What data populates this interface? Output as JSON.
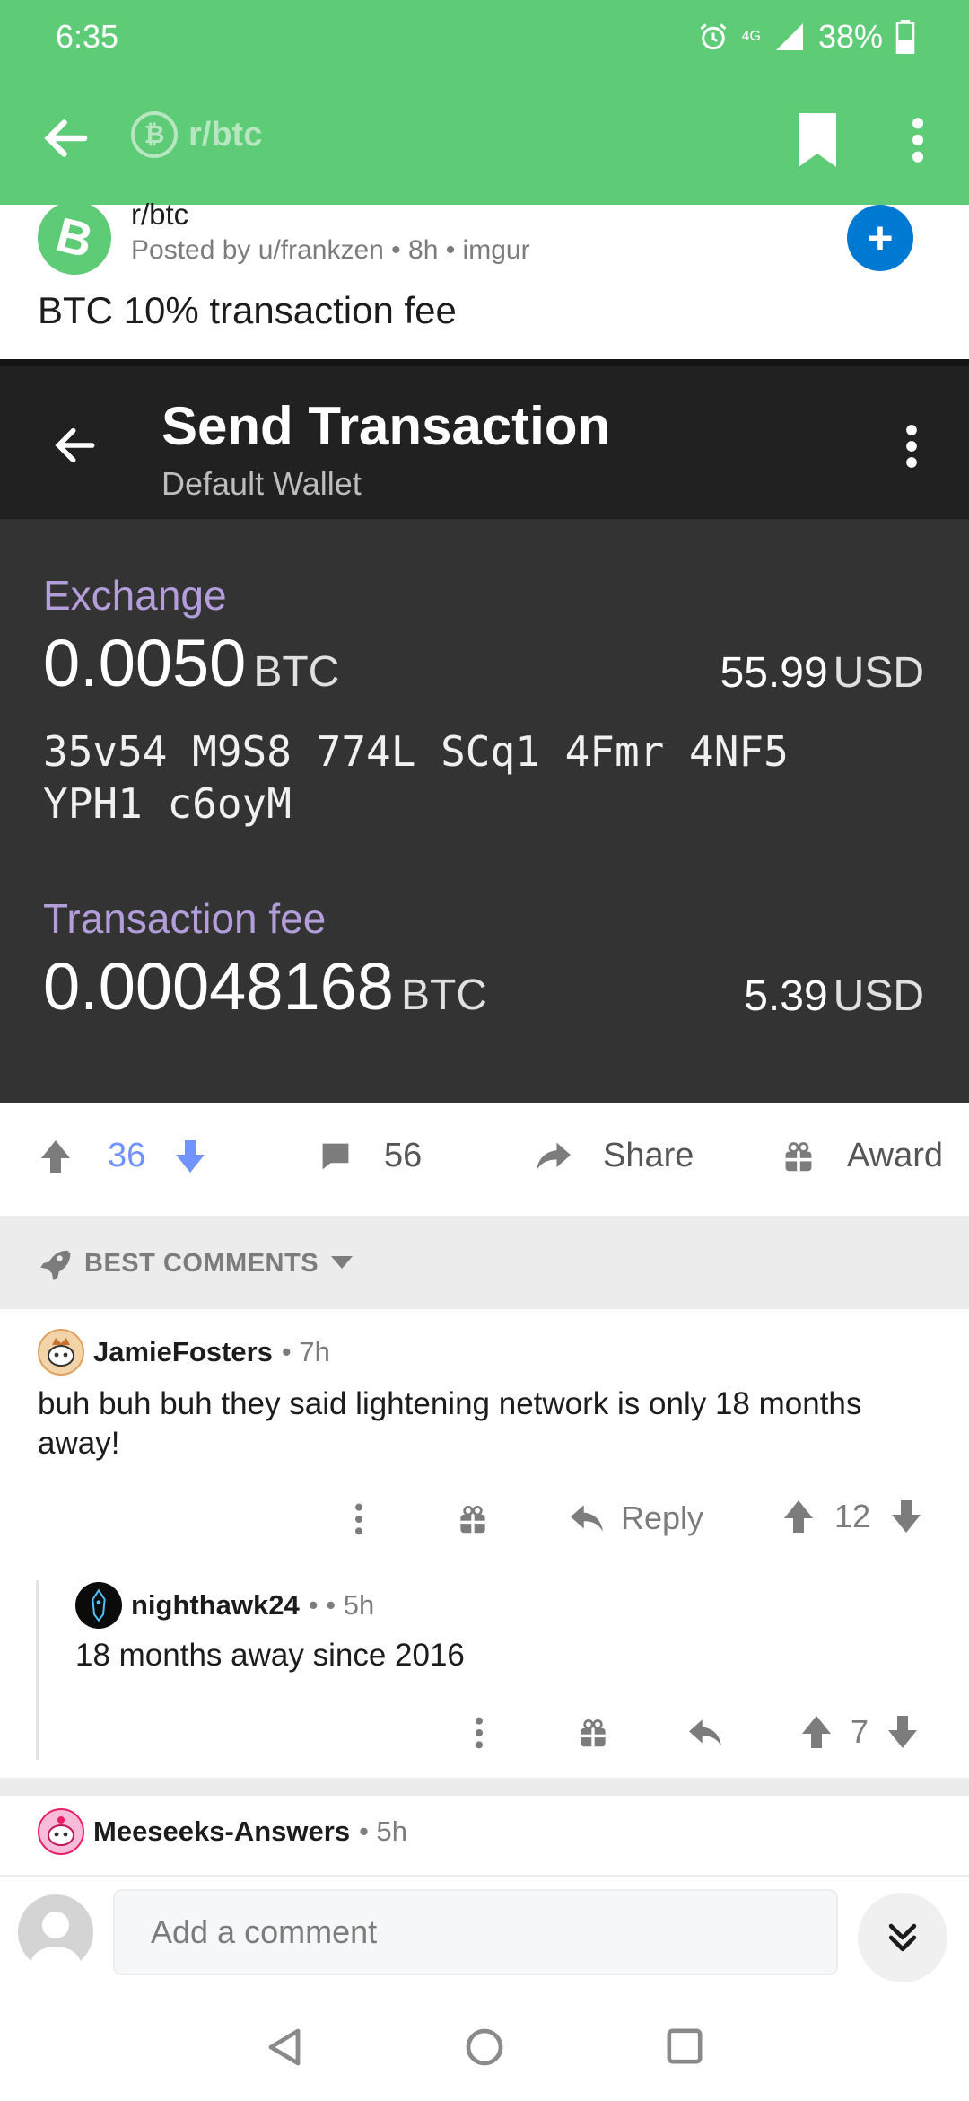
{
  "status": {
    "time": "6:35",
    "network": "4G",
    "battery": "38%"
  },
  "app_bar": {
    "subreddit": "r/btc"
  },
  "post": {
    "subreddit": "r/btc",
    "meta": "Posted by u/frankzen • 8h • imgur",
    "title": "BTC 10% transaction fee",
    "avatar_letter": "B",
    "join_symbol": "+"
  },
  "wallet": {
    "title": "Send Transaction",
    "subtitle": "Default Wallet",
    "exchange_label": "Exchange",
    "exchange_amount": "0.0050",
    "exchange_unit": "BTC",
    "exchange_usd": "55.99",
    "usd_unit": "USD",
    "address_line1": "35v54 M9S8 774L SCq1 4Fmr 4NF5",
    "address_line2": "YPH1 c6oyM",
    "fee_label": "Transaction fee",
    "fee_amount": "0.00048168",
    "fee_unit": "BTC",
    "fee_usd": "5.39"
  },
  "actions": {
    "score": "36",
    "comments": "56",
    "share": "Share",
    "award": "Award"
  },
  "sort": {
    "label": "BEST COMMENTS"
  },
  "comments": [
    {
      "author": "JamieFosters",
      "time": "• 7h",
      "body": "buh buh buh they said lightening network is only 18 months away!",
      "reply": "Reply",
      "score": "12"
    },
    {
      "author": "nighthawk24",
      "time": "• • 5h",
      "body": "18 months away since 2016",
      "score": "7"
    },
    {
      "author": "Meeseeks-Answers",
      "time": "• 5h"
    }
  ],
  "comment_bar": {
    "placeholder": "Add a comment"
  },
  "colors": {
    "brand_green": "#5ecb77",
    "upvote_blue": "#7193ff",
    "join_blue": "#0079d3",
    "wallet_bg": "#333333",
    "wallet_label": "#b39ddb"
  }
}
